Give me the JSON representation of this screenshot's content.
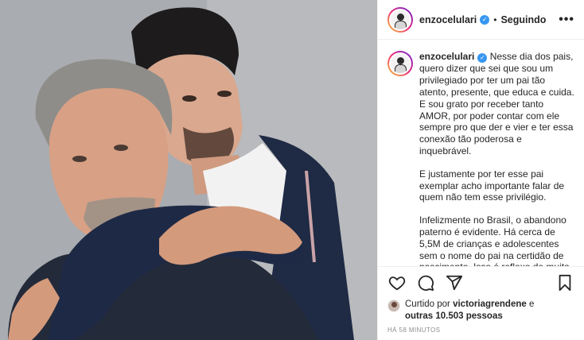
{
  "post": {
    "author": "enzocelulari",
    "follow_status": "Seguindo",
    "separator": "•",
    "more_icon": "more-horizontal-icon",
    "verified_icon": "verified-badge-icon",
    "verified_glyph": "✓"
  },
  "caption": {
    "author": "enzocelulari",
    "paragraphs": [
      "Nesse dia dos pais, quero dizer que sei que sou um privilegiado por ter um pai tão atento, presente, que educa e cuida. E sou grato por receber tanto AMOR, por poder contar com ele sempre pro que der e vier e ter essa conexão tão poderosa e inquebrável.",
      "E justamente por ter esse pai exemplar acho importante falar de quem não tem esse privilégio.",
      "Infelizmente no Brasil, o abandono paterno é evidente. Há cerca de 5,5M de crianças e adolescentes sem o nome do pai na certidão de nascimento. Isso é reflexo de muita coisa que precisa mudar"
    ]
  },
  "actions": {
    "like_icon": "heart-icon",
    "comment_icon": "comment-icon",
    "share_icon": "share-icon",
    "save_icon": "bookmark-icon"
  },
  "likes": {
    "prefix": "Curtido por",
    "user": "victoriagrendene",
    "connector": "e",
    "others": "outras 10.503 pessoas"
  },
  "timestamp": "HÁ 58 MINUTOS",
  "colors": {
    "verified": "#3897f0",
    "text": "#262626",
    "muted": "#8e8e8e",
    "border": "#efefef"
  }
}
